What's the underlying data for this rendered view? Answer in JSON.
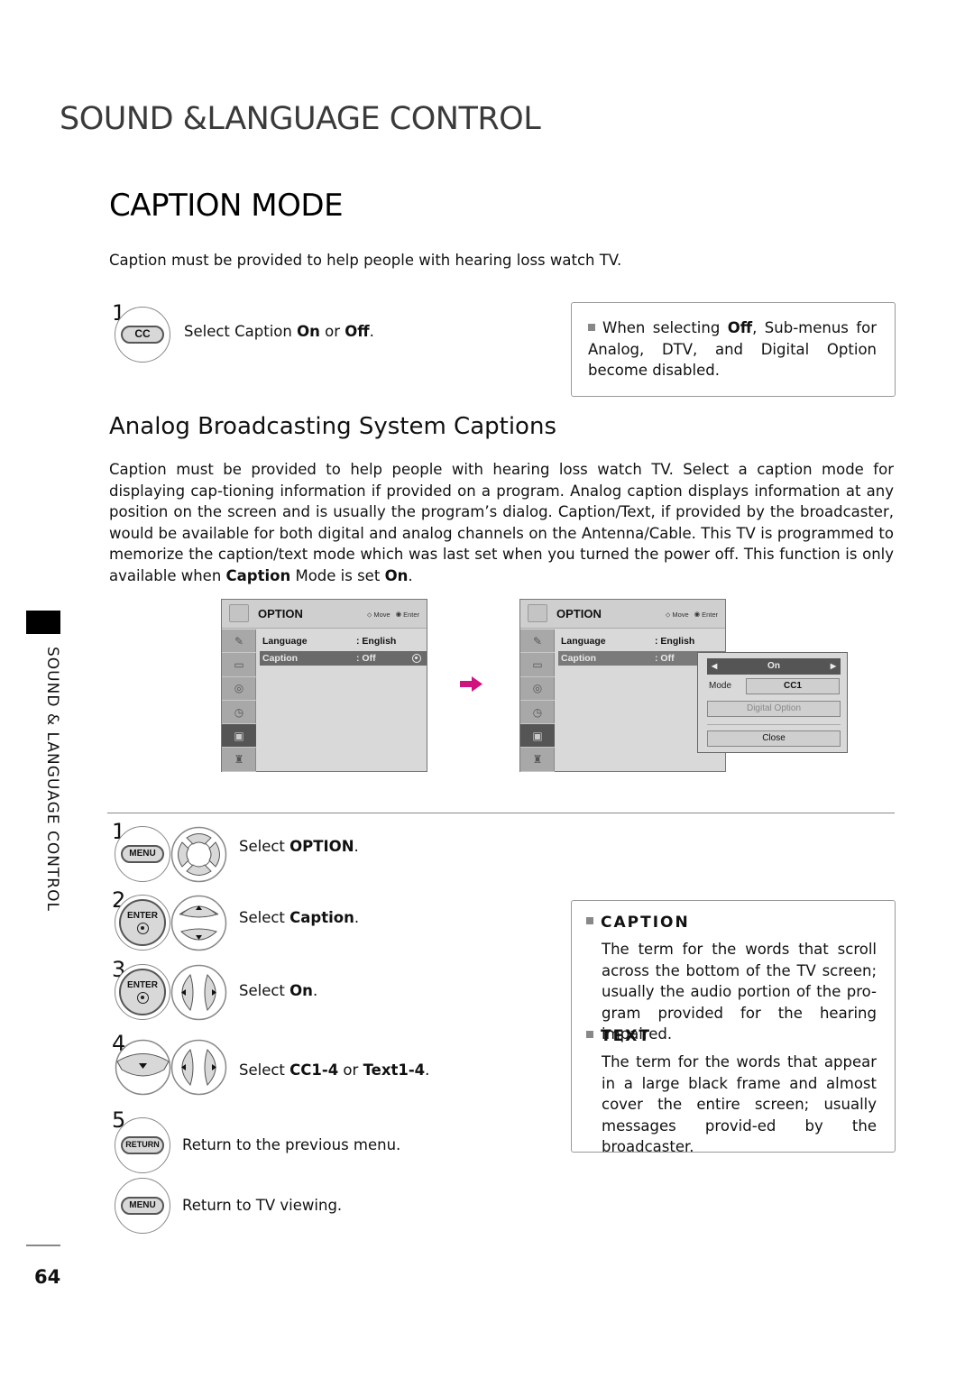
{
  "header": {
    "section_title": "SOUND &LANGUAGE CONTROL",
    "page_title": "CAPTION MODE",
    "intro": "Caption must be provided to help people with hearing loss watch TV."
  },
  "cc_step": {
    "number": "1",
    "button_label": "CC",
    "text_prefix": "Select Caption ",
    "on": "On",
    "or": " or ",
    "off": "Off",
    "suffix": "."
  },
  "note_off": {
    "prefix": "When selecting ",
    "bold": "Off",
    "rest": ", Sub-menus for Analog, DTV, and Digital Option become disabled."
  },
  "analog": {
    "heading": "Analog Broadcasting System Captions",
    "paragraph_main": "Caption must be provided to help people with hearing loss watch TV. Select a caption mode for displaying cap-tioning information if provided on a program. Analog caption displays information at any position on the screen and is usually the program’s dialog. Caption/Text, if provided by the broadcaster, would be available for both digital and analog channels on the Antenna/Cable. This TV is programmed to memorize the caption/text mode which was last set when you turned the power off. This function is only available when ",
    "paragraph_bold1": "Caption",
    "paragraph_mid": " Mode is set ",
    "paragraph_bold2": "On",
    "paragraph_end": "."
  },
  "sidebar": {
    "label": "SOUND & LANGUAGE CONTROL",
    "page_number": "64"
  },
  "tv_menu_before": {
    "title": "OPTION",
    "hint_move": "Move",
    "hint_enter": "Enter",
    "rows": [
      {
        "label": "Language",
        "value": ": English"
      },
      {
        "label": "Caption",
        "value": ": Off"
      }
    ]
  },
  "tv_menu_after": {
    "title": "OPTION",
    "hint_move": "Move",
    "hint_enter": "Enter",
    "rows": [
      {
        "label": "Language",
        "value": ": English"
      },
      {
        "label": "Caption",
        "value": ": Off"
      }
    ],
    "popup": {
      "state": "On",
      "mode_label": "Mode",
      "mode_value": "CC1",
      "digital_option": "Digital Option",
      "close": "Close"
    }
  },
  "arrow_color": "#d0147f",
  "steps": [
    {
      "number": "1",
      "button": "MENU",
      "text_prefix": "Select ",
      "bold": "OPTION",
      "suffix": "."
    },
    {
      "number": "2",
      "button": "ENTER",
      "text_prefix": "Select ",
      "bold": "Caption",
      "suffix": "."
    },
    {
      "number": "3",
      "button": "ENTER",
      "text_prefix": "Select ",
      "bold": "On",
      "suffix": "."
    },
    {
      "number": "4",
      "text_prefix": "Select ",
      "bold": "CC1-4",
      "mid": " or ",
      "bold2": "Text1-4",
      "suffix": "."
    },
    {
      "number": "5",
      "button": "RETURN",
      "text": "Return to the previous menu."
    },
    {
      "button": "MENU",
      "text": "Return to TV viewing."
    }
  ],
  "glossary": [
    {
      "term": "CAPTION",
      "definition": "The term for the words that scroll across the bottom of the TV screen; usually the audio portion of the pro-gram provided for the hearing impaired."
    },
    {
      "term": "TEXT",
      "definition": "The term for the words that appear in a large black frame and almost cover the entire screen; usually messages provid-ed by the broadcaster."
    }
  ]
}
